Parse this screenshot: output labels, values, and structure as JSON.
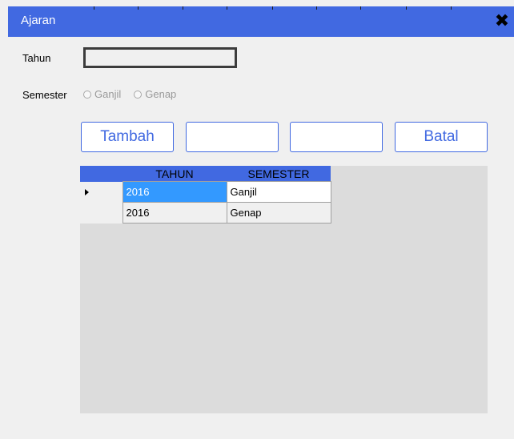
{
  "window": {
    "title": "Ajaran",
    "accent": "#4169e1"
  },
  "form": {
    "tahun_label": "Tahun",
    "tahun_value": "",
    "semester_label": "Semester",
    "semester_options": [
      "Ganjil",
      "Genap"
    ],
    "semester_selected": null
  },
  "buttons": {
    "tambah": "Tambah",
    "button2": "",
    "button3": "",
    "batal": "Batal"
  },
  "grid": {
    "columns": [
      "TAHUN",
      "SEMESTER"
    ],
    "rows": [
      {
        "tahun": "2016",
        "semester": "Ganjil",
        "selected": true
      },
      {
        "tahun": "2016",
        "semester": "Genap",
        "selected": false
      }
    ]
  }
}
